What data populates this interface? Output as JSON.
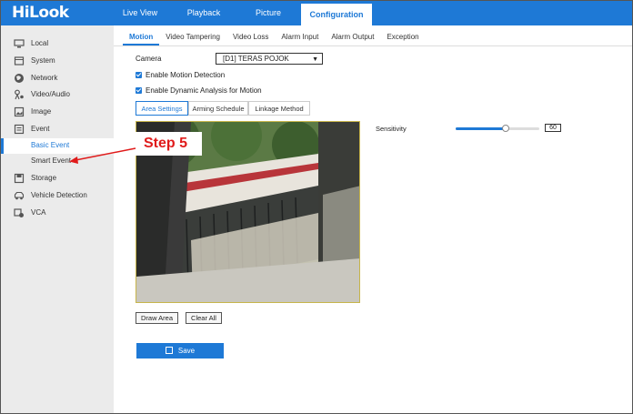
{
  "logo": "HiLook",
  "main_nav": [
    {
      "label": "Live View",
      "active": false
    },
    {
      "label": "Playback",
      "active": false
    },
    {
      "label": "Picture",
      "active": false
    },
    {
      "label": "Configuration",
      "active": true
    }
  ],
  "sidebar": {
    "items": [
      {
        "label": "Local",
        "icon": "monitor-icon"
      },
      {
        "label": "System",
        "icon": "system-icon"
      },
      {
        "label": "Network",
        "icon": "globe-icon"
      },
      {
        "label": "Video/Audio",
        "icon": "video-audio-icon"
      },
      {
        "label": "Image",
        "icon": "image-icon"
      },
      {
        "label": "Event",
        "icon": "event-icon"
      },
      {
        "label": "Storage",
        "icon": "storage-icon"
      },
      {
        "label": "Vehicle Detection",
        "icon": "vehicle-icon"
      },
      {
        "label": "VCA",
        "icon": "vca-icon"
      }
    ],
    "sub_items": [
      {
        "label": "Basic Event",
        "active": true
      },
      {
        "label": "Smart Event",
        "active": false
      }
    ]
  },
  "sub_tabs": [
    {
      "label": "Motion",
      "active": true
    },
    {
      "label": "Video Tampering",
      "active": false
    },
    {
      "label": "Video Loss",
      "active": false
    },
    {
      "label": "Alarm Input",
      "active": false
    },
    {
      "label": "Alarm Output",
      "active": false
    },
    {
      "label": "Exception",
      "active": false
    }
  ],
  "camera": {
    "label": "Camera",
    "value": "[D1] TERAS POJOK"
  },
  "checkboxes": [
    {
      "label": "Enable Motion Detection",
      "checked": true
    },
    {
      "label": "Enable Dynamic Analysis for Motion",
      "checked": true
    }
  ],
  "inner_tabs": [
    {
      "label": "Area Settings",
      "active": true
    },
    {
      "label": "Arming Schedule",
      "active": false
    },
    {
      "label": "Linkage Method",
      "active": false
    }
  ],
  "sensitivity": {
    "label": "Sensitivity",
    "value": "60",
    "fraction": 0.6
  },
  "buttons": {
    "draw_area": "Draw Area",
    "clear_all": "Clear All",
    "save": "Save"
  },
  "annotation": {
    "text": "Step 5",
    "color": "#e01b1b"
  },
  "colors": {
    "accent": "#1e79d6",
    "sidebar_bg": "#ebebeb"
  }
}
